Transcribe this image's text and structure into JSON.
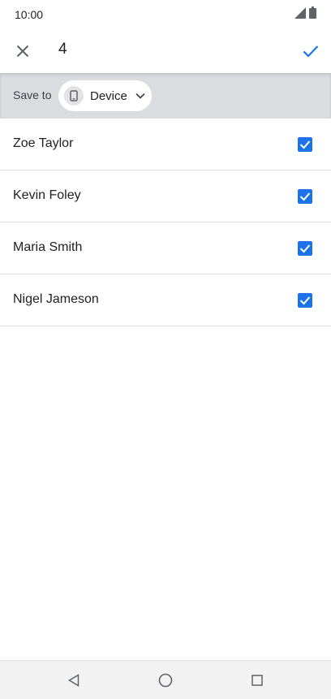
{
  "status_bar": {
    "time": "10:00",
    "icons": [
      "signal-icon",
      "battery-icon"
    ]
  },
  "toolbar": {
    "close_icon": "close-icon",
    "selected_count": "4",
    "confirm_icon": "check-icon"
  },
  "save_to": {
    "label": "Save to",
    "chip_icon": "phone-icon",
    "chip_label": "Device",
    "chip_chevron": "chevron-down-icon"
  },
  "contacts": [
    {
      "name": "Zoe Taylor",
      "checked": true
    },
    {
      "name": "Kevin Foley",
      "checked": true
    },
    {
      "name": "Maria Smith",
      "checked": true
    },
    {
      "name": "Nigel Jameson",
      "checked": true
    }
  ],
  "nav_bar": {
    "back_icon": "back-icon",
    "home_icon": "home-icon",
    "recents_icon": "recents-icon"
  },
  "colors": {
    "accent": "#1a73e8",
    "save_bar_bg": "#dadce0",
    "divider": "#dadce0"
  }
}
